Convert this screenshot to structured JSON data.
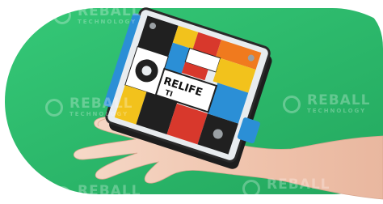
{
  "brand": {
    "label_on_device": "RELIFE",
    "label_suffix": "TI"
  },
  "watermark": {
    "line1": "REBALL",
    "line2": "TECHNOLOGY"
  },
  "colors": {
    "background_green": "#2fbd6e",
    "green_dark": "#1f9a55",
    "device_black": "#202020",
    "device_red": "#d8382c",
    "device_yellow": "#f2c21c",
    "device_blue": "#2b8fd6",
    "device_orange": "#f07a1e",
    "skin": "#f1c8b3"
  }
}
